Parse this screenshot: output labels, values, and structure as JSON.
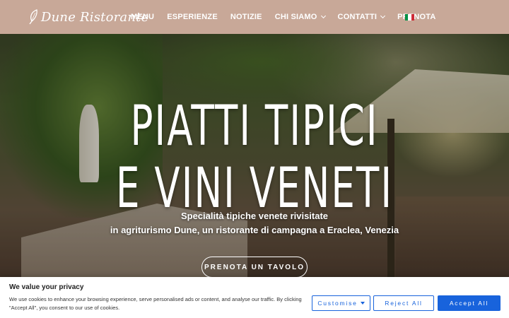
{
  "header": {
    "logo_text": "Dune Ristorante",
    "nav": [
      {
        "label": "MENU",
        "dropdown": false
      },
      {
        "label": "ESPERIENZE",
        "dropdown": false
      },
      {
        "label": "NOTIZIE",
        "dropdown": false
      },
      {
        "label": "CHI SIAMO",
        "dropdown": true
      },
      {
        "label": "CONTATTI",
        "dropdown": true
      },
      {
        "label": "PRENOTA",
        "dropdown": false
      }
    ],
    "language_flag": "it-flag-icon",
    "colors": {
      "header_bg": "#c8a898",
      "flag": [
        "#009246",
        "#ffffff",
        "#ce2b37"
      ]
    }
  },
  "hero": {
    "title_line1": "PIATTI TIPICI",
    "title_line2": "E VINI VENETI",
    "subtitle_line1": "Specialità tipiche venete rivisitate",
    "subtitle_line2": "in agriturismo Dune, un ristorante di campagna a Eraclea, Venezia",
    "cta_label": "PRENOTA UN TAVOLO"
  },
  "cookie_banner": {
    "title": "We value your privacy",
    "text": "We use cookies to enhance your browsing experience, serve personalised ads or content, and analyse our traffic. By clicking \"Accept All\", you consent to our use of cookies.",
    "customise_label": "Customise",
    "reject_label": "Reject All",
    "accept_label": "Accept All",
    "accent_color": "#1863dc"
  }
}
